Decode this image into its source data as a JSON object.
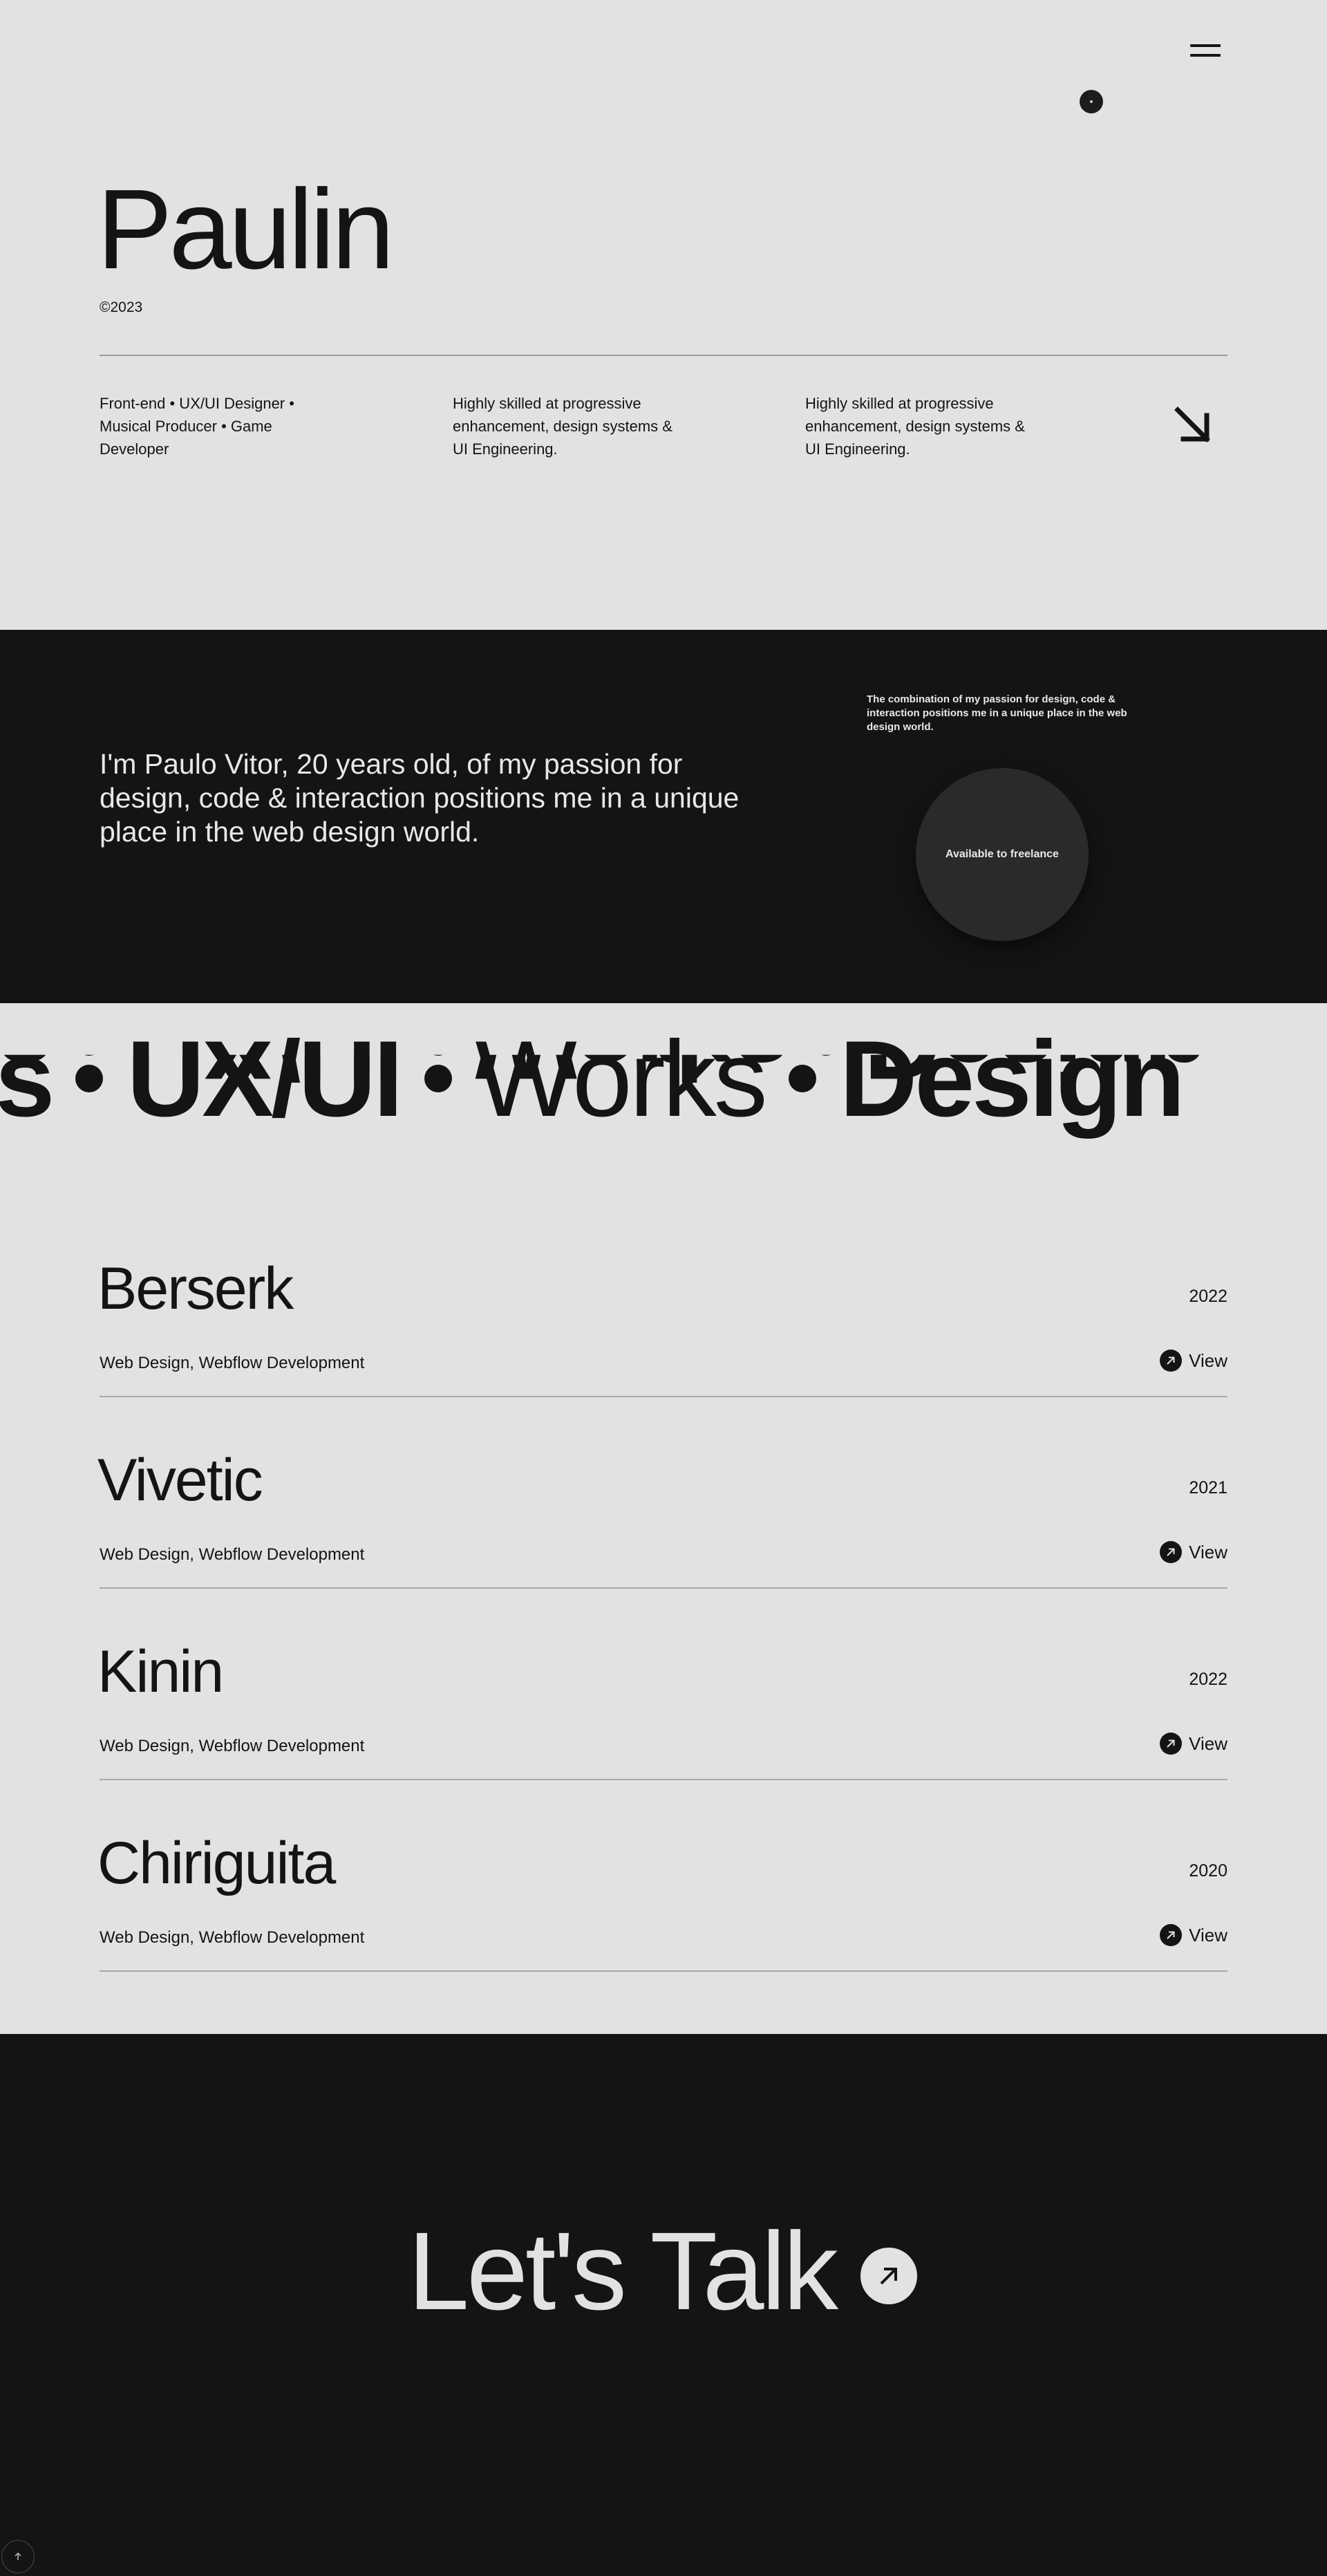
{
  "hero": {
    "title": "Paulin",
    "copyright": "©2023",
    "columns": [
      "Front-end • UX/UI Designer • Musical Producer • Game Developer",
      "Highly skilled at progressive enhancement, design systems & UI Engineering.",
      "Highly skilled at progressive enhancement, design systems & UI Engineering."
    ]
  },
  "icons": {
    "menu": "hamburger-menu-icon",
    "hero_arrow": "arrow-down-right-icon",
    "view": "arrow-up-right-icon",
    "talk": "arrow-up-right-icon",
    "scroll_top": "arrow-up-icon"
  },
  "about": {
    "text": "I'm Paulo Vitor, 20 years old, of my passion for design, code & interaction positions me in a unique place in the web design world.",
    "note": "The combination of my passion for design, code & interaction positions me in a unique place in the web design world.",
    "badge": "Available to freelance"
  },
  "marquee": {
    "words": [
      "cts",
      "UX/UI",
      "Works",
      "Design"
    ]
  },
  "projects": [
    {
      "title": "Berserk",
      "year": "2022",
      "tags": "Web Design, Webflow Development",
      "view": "View"
    },
    {
      "title": "Vivetic",
      "year": "2021",
      "tags": "Web Design, Webflow Development",
      "view": "View"
    },
    {
      "title": "Kinin",
      "year": "2022",
      "tags": "Web Design, Webflow Development",
      "view": "View"
    },
    {
      "title": "Chiriguita",
      "year": "2020",
      "tags": "Web Design, Webflow Development",
      "view": "View"
    }
  ],
  "contact": {
    "cta": "Let's Talk"
  },
  "colors": {
    "background_light": "#e2e2e2",
    "background_dark": "#141414",
    "badge": "#2a2a2a"
  }
}
